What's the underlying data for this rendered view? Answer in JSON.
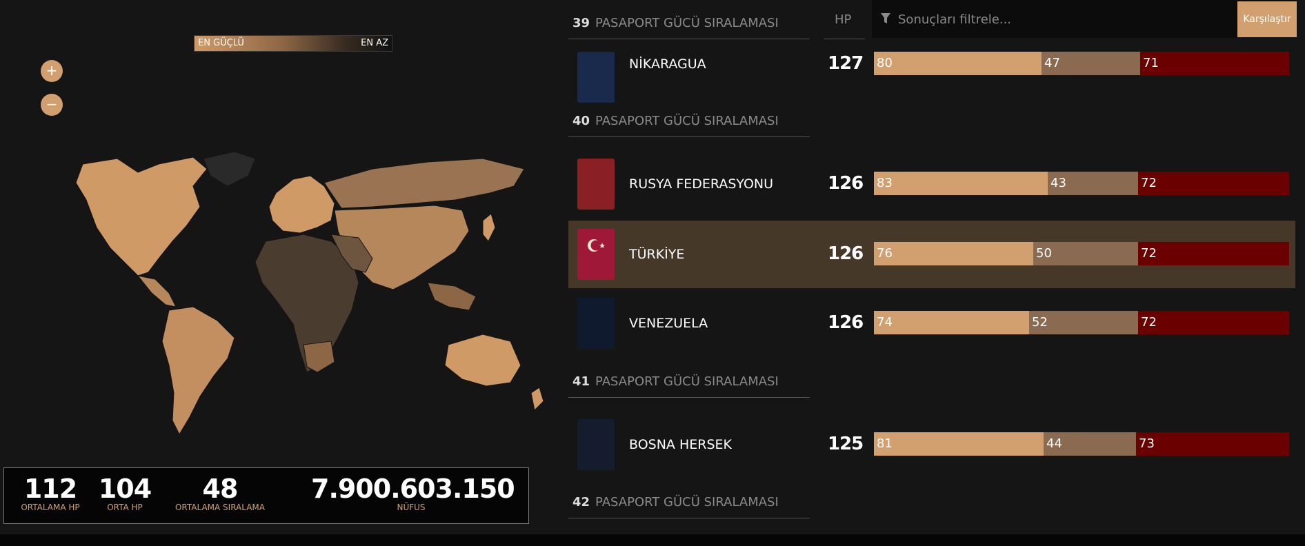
{
  "legend": {
    "left": "EN GÜÇLÜ",
    "right": "EN AZ"
  },
  "zoom": {
    "in": "+",
    "out": "−"
  },
  "stats": [
    {
      "value": "112",
      "label": "ORTALAMA HP"
    },
    {
      "value": "104",
      "label": "ORTA HP"
    },
    {
      "value": "48",
      "label": "ORTALAMA SIRALAMA"
    },
    {
      "value": "7.900.603.150",
      "label": "NÜFUS"
    }
  ],
  "header": {
    "hp_label": "HP"
  },
  "filter": {
    "placeholder": "Sonuçları filtrele...",
    "button": "Karşılaştır",
    "icon": "filter-icon"
  },
  "rank_heading_text": "PASAPORT GÜCÜ SIRALAMASI",
  "ranks": [
    {
      "number": "39"
    },
    {
      "number": "40"
    },
    {
      "number": "41"
    },
    {
      "number": "42"
    }
  ],
  "countries": [
    {
      "name": "NİKARAGUA",
      "hp": "127",
      "v1": "80",
      "v2": "47",
      "v3": "71",
      "passport_color": "#1a2a4d"
    },
    {
      "name": "RUSYA FEDERASYONU",
      "hp": "126",
      "v1": "83",
      "v2": "43",
      "v3": "72",
      "passport_color": "#8a1f26"
    },
    {
      "name": "TÜRKİYE",
      "hp": "126",
      "v1": "76",
      "v2": "50",
      "v3": "72",
      "passport_color": "#a01838",
      "highlighted": true
    },
    {
      "name": "VENEZUELA",
      "hp": "126",
      "v1": "74",
      "v2": "52",
      "v3": "72",
      "passport_color": "#0f1a2e"
    },
    {
      "name": "BOSNA HERSEK",
      "hp": "125",
      "v1": "81",
      "v2": "44",
      "v3": "73",
      "passport_color": "#141c2e"
    }
  ],
  "colors": {
    "accent": "#d2a06f",
    "mid": "#8a6b52",
    "dark_red": "#6b0000"
  }
}
